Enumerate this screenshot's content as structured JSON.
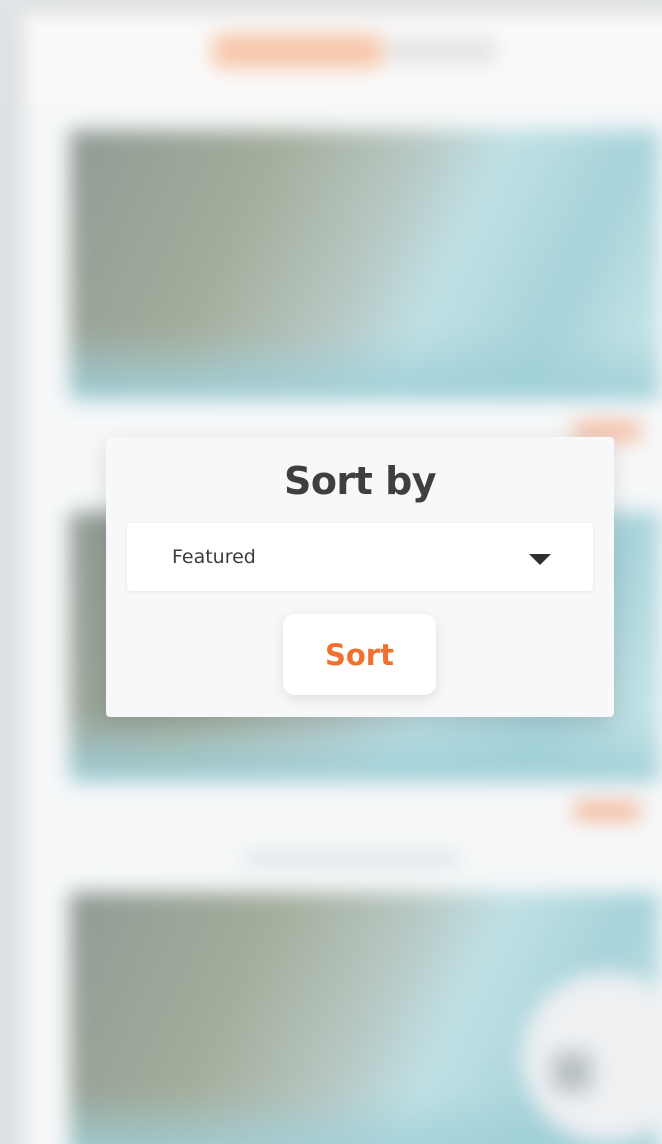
{
  "modal": {
    "title": "Sort by",
    "sort_select": {
      "selected_value": "Featured",
      "caret_icon": "caret-down-icon"
    },
    "sort_button_label": "Sort"
  },
  "colors": {
    "accent": "#f2702e",
    "title_text": "#3f3f3f",
    "modal_background": "#f7f8f9"
  }
}
